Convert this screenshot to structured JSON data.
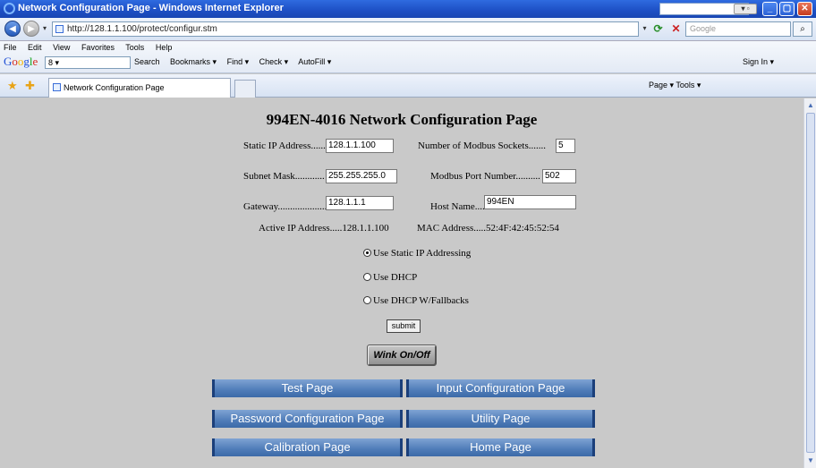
{
  "window": {
    "title": "Network Configuration Page - Windows Internet Explorer",
    "address": "http://128.1.1.100/protect/configur.stm",
    "search_placeholder": "Google"
  },
  "menu": [
    "File",
    "Edit",
    "View",
    "Favorites",
    "Tools",
    "Help"
  ],
  "google_toolbar": {
    "search_value": "8 ▾",
    "items": [
      "Search",
      "Bookmarks ▾",
      "Find ▾",
      "Check ▾",
      "AutoFill ▾"
    ],
    "signin": "Sign In ▾"
  },
  "tab": {
    "label": "Network Configuration Page",
    "tools": "Page ▾  Tools ▾"
  },
  "page": {
    "title": "994EN-4016 Network Configuration Page",
    "static_ip_label": "Static IP Address......",
    "static_ip_value": "128.1.1.100",
    "subnet_label": "Subnet Mask............",
    "subnet_value": "255.255.255.0",
    "gateway_label": "Gateway.....................",
    "gateway_value": "128.1.1.1",
    "sockets_label": "Number of Modbus Sockets.......",
    "sockets_value": "5",
    "port_label": "Modbus Port Number..........",
    "port_value": "502",
    "host_label": "Host Name.....",
    "host_value": "994EN",
    "active_ip": "Active IP Address.....128.1.1.100",
    "mac": "MAC Address.....52:4F:42:45:52:54",
    "radio_static": "Use Static IP Addressing",
    "radio_dhcp": "Use DHCP",
    "radio_dhcp_fallback": "Use DHCP W/Fallbacks",
    "submit": "submit",
    "wink": "Wink On/Off"
  },
  "nav_buttons": {
    "test": "Test Page",
    "input_config": "Input Configuration Page",
    "password_config": "Password Configuration Page",
    "utility": "Utility Page",
    "calibration": "Calibration Page",
    "home": "Home Page"
  }
}
